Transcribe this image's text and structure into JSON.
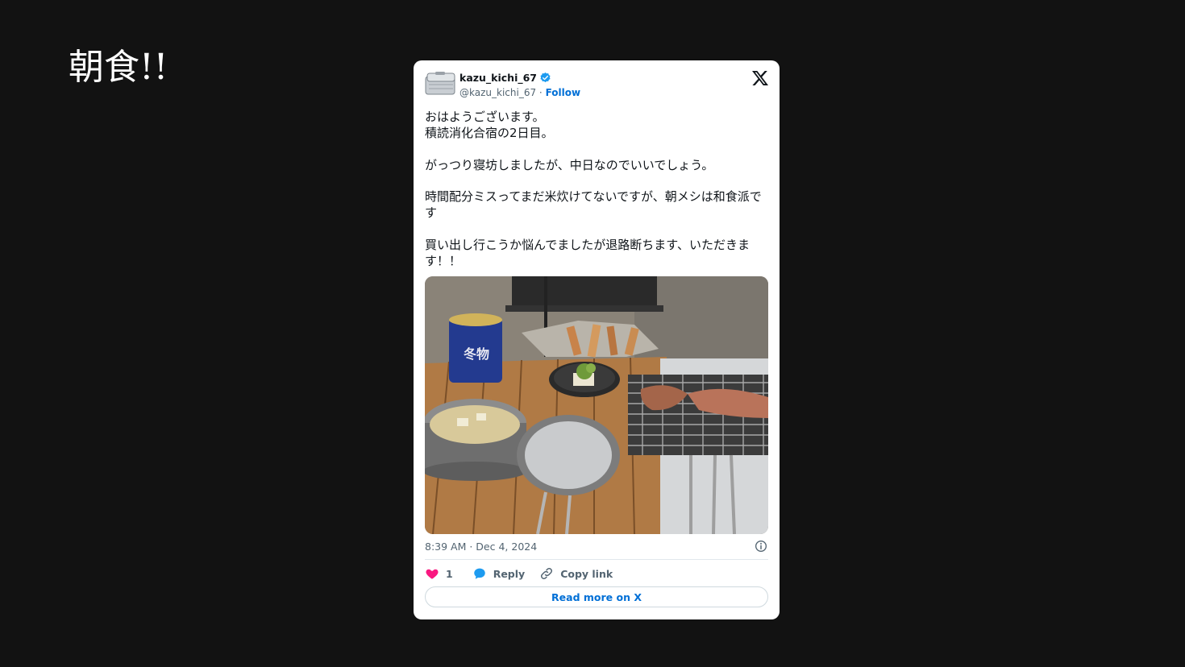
{
  "slide": {
    "title": "朝食!!"
  },
  "tweet": {
    "display_name": "kazu_kichi_67",
    "handle": "@kazu_kichi_67",
    "separator": "·",
    "follow_label": "Follow",
    "verified": true,
    "paragraphs": [
      [
        "おはようございます。",
        "積読消化合宿の2日目。"
      ],
      [
        "がっつり寝坊しましたが、中日なのでいいでしょう。"
      ],
      [
        "時間配分ミスってまだ米炊けてないですが、朝メシは和食派です"
      ],
      [
        "買い出し行こうか悩んでましたが退路断ちます、いただきます！！"
      ]
    ],
    "timestamp": "8:39 AM · Dec 4, 2024",
    "like_count": "1",
    "reply_label": "Reply",
    "copy_link_label": "Copy link",
    "read_more_label": "Read more on X"
  },
  "colors": {
    "background": "#121212",
    "card": "#ffffff",
    "link": "#006fd6",
    "like": "#f91880",
    "reply": "#1d9bf0",
    "muted": "#536471",
    "verified": "#1d9bf0"
  },
  "icons": [
    "avatar-mess-tin",
    "verified-badge-icon",
    "x-logo-icon",
    "info-icon",
    "heart-icon",
    "reply-bubble-icon",
    "link-icon"
  ]
}
